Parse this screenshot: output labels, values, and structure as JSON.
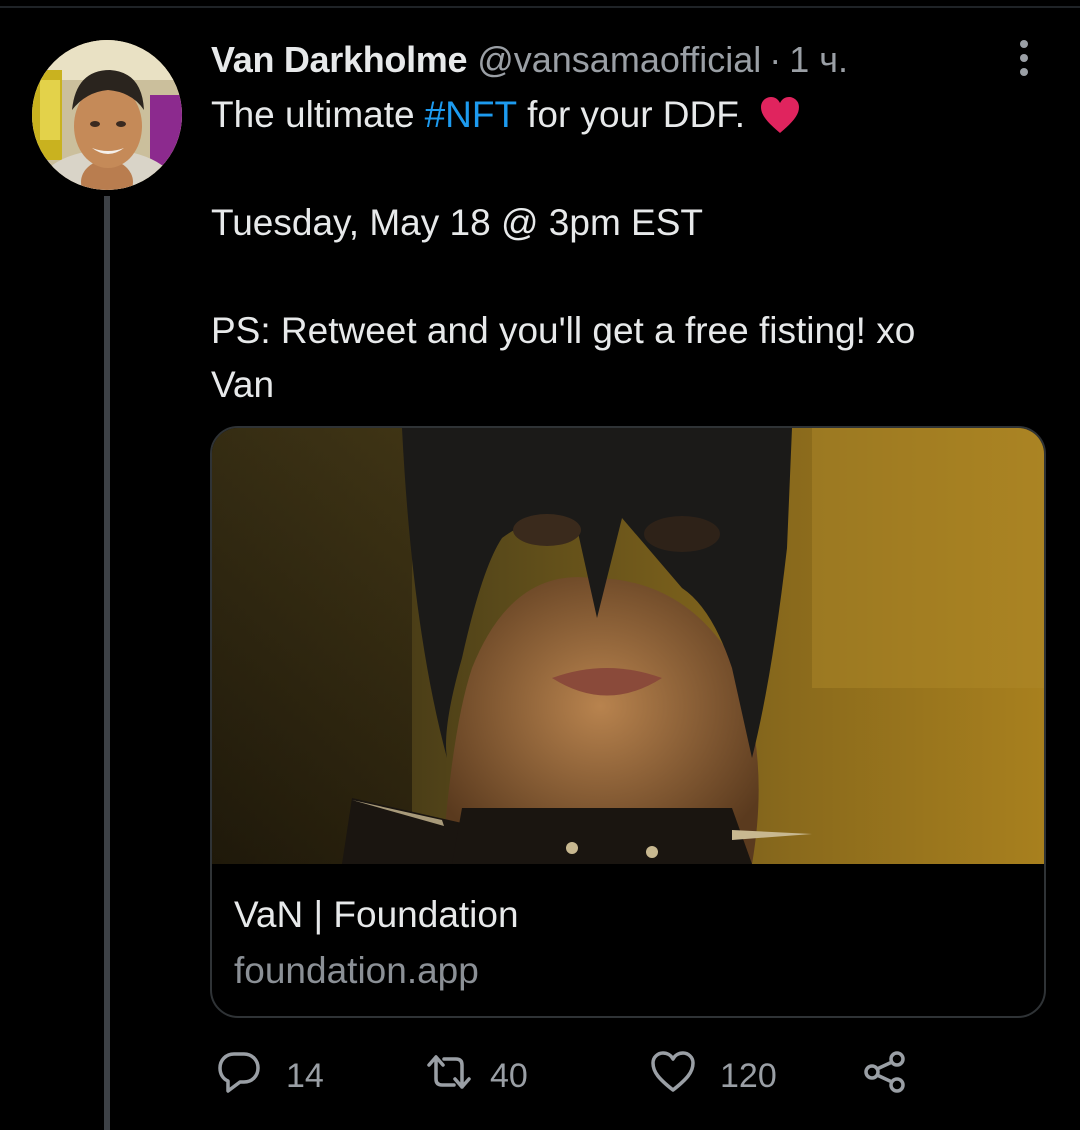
{
  "tweet": {
    "display_name": "Van Darkholme",
    "handle": "@vansamaofficial",
    "separator": "·",
    "time": "1 ч.",
    "text_prefix": "The ultimate",
    "hashtag": "#NFT",
    "text_suffix": "for your DDF.",
    "line_date": "Tuesday, May 18 @ 3pm EST",
    "line_ps_1": "PS: Retweet and you'll get a free fisting! xo",
    "line_ps_2": "Van"
  },
  "card": {
    "title": "VaN | Foundation",
    "domain": "foundation.app"
  },
  "actions": {
    "replies": "14",
    "retweets": "40",
    "likes": "120"
  },
  "colors": {
    "background": "#000000",
    "text": "#e7e9ea",
    "secondary_text": "#9a9fa5",
    "link": "#1d9bf0",
    "heart": "#e0245e",
    "border": "#2f3336"
  },
  "icons": {
    "more": "more-vertical-icon",
    "reply": "reply-icon",
    "retweet": "retweet-icon",
    "like": "like-icon",
    "share": "share-icon",
    "emoji": "red-heart-emoji"
  }
}
